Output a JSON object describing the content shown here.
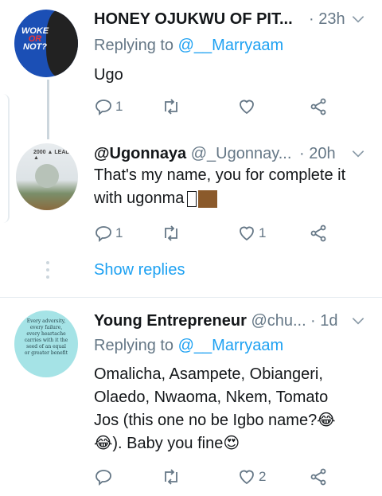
{
  "tweets": [
    {
      "name": "HONEY OJUKWU OF PIT...",
      "handle": "",
      "time": "23h",
      "reply_label": "Replying to",
      "reply_mention": "@__Marryaam",
      "text": "Ugo",
      "avatar_text": [
        "WOKE",
        "OR",
        "NOT?"
      ],
      "reply_count": "1",
      "retweet_count": "",
      "like_count": ""
    },
    {
      "name": "@Ugonnaya",
      "handle": "@_Ugonnay...",
      "time": "20h",
      "text_line1": "That's my name, you for complete it",
      "text_line2": "with ugonma",
      "reply_count": "1",
      "retweet_count": "",
      "like_count": "1"
    },
    {
      "name": "Young Entrepreneur",
      "handle": "@chu...",
      "time": "1d",
      "reply_label": "Replying to",
      "reply_mention": "@__Marryaam",
      "text_line1": "Omalicha, Asampete, Obiangeri,",
      "text_line2": "Olaedo, Nwaoma, Nkem, Tomato",
      "text_line3": "Jos (this one no be Igbo name?😂",
      "text_line4": "😂). Baby you fine😍",
      "avatar_quote": "Every adversity, every failure, every heartache carries with it the seed of an equal or greater benefit",
      "reply_count": "",
      "retweet_count": "",
      "like_count": "2"
    }
  ],
  "show_replies": "Show replies",
  "colors": {
    "link": "#1da1f2",
    "secondary": "#657786",
    "text": "#14171a",
    "line": "#ccd6dd"
  }
}
